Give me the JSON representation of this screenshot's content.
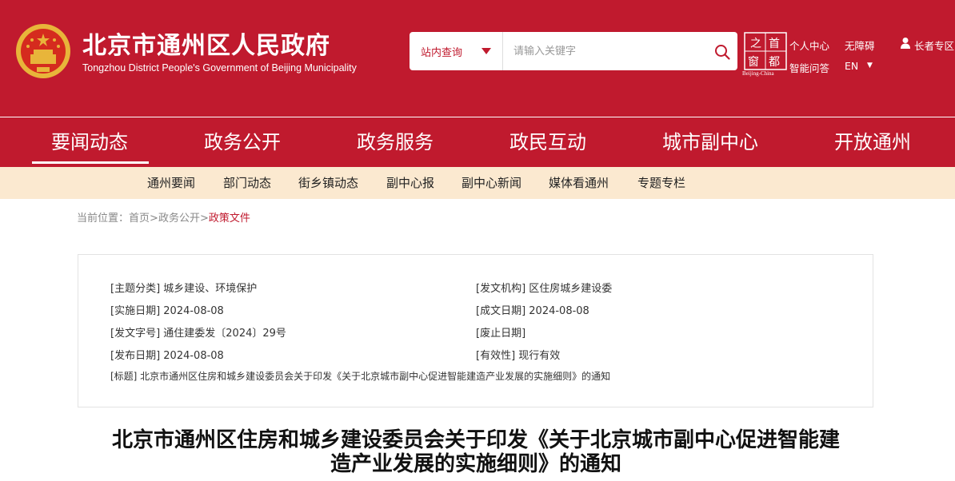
{
  "header": {
    "title": "北京市通州区人民政府",
    "subtitle": "Tongzhou District People's Government of Beijing Municipality",
    "search": {
      "scope_label": "站内查询",
      "placeholder": "请输入关键字"
    },
    "capital_logo_caption": "Beijing-China",
    "links": {
      "personal_center": "个人中心",
      "accessibility": "无障碍",
      "elder_zone": "长者专区",
      "smart_qa": "智能问答",
      "language": "EN"
    },
    "colors": {
      "brand_red": "#c01a2e",
      "subnav_bg": "#fbe9d0"
    }
  },
  "main_nav": [
    "要闻动态",
    "政务公开",
    "政务服务",
    "政民互动",
    "城市副中心",
    "开放通州"
  ],
  "sub_nav": [
    "通州要闻",
    "部门动态",
    "街乡镇动态",
    "副中心报",
    "副中心新闻",
    "媒体看通州",
    "专题专栏"
  ],
  "breadcrumb": {
    "prefix": "当前位置：",
    "home": "首页",
    "sep1": ">",
    "section": "政务公开",
    "sep2": ">",
    "current": "政策文件"
  },
  "meta": {
    "topic": "[主题分类] 城乡建设、环境保护",
    "issuer": "[发文机构] 区住房城乡建设委",
    "effective_date": "[实施日期] 2024-08-08",
    "written_date": "[成文日期] 2024-08-08",
    "doc_number": "[发文字号] 通住建委发〔2024〕29号",
    "repeal_date": "[废止日期]",
    "publish_date": "[发布日期] 2024-08-08",
    "validity": "[有效性] 现行有效",
    "title": "[标题] 北京市通州区住房和城乡建设委员会关于印发《关于北京城市副中心促进智能建造产业发展的实施细则》的通知"
  },
  "article": {
    "title_line1": "北京市通州区住房和城乡建设委员会关于印发《关于北京城市副中心促进智能建",
    "title_line2": "造产业发展的实施细则》的通知"
  }
}
